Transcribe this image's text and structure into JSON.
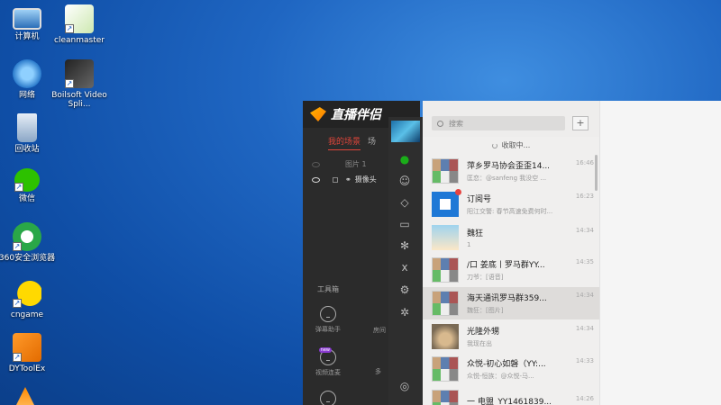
{
  "desktop": {
    "icons": [
      {
        "label": "计算机",
        "icon": "computer-icon"
      },
      {
        "label": "cleanmaster",
        "icon": "cleanmaster-icon"
      },
      {
        "label": "网络",
        "icon": "network-icon"
      },
      {
        "label": "Boilsoft Video Spli...",
        "icon": "video-splitter-icon"
      },
      {
        "label": "回收站",
        "icon": "recycle-bin-icon"
      },
      {
        "label": "微信",
        "icon": "wechat-icon"
      },
      {
        "label": "360安全浏览器",
        "icon": "360-browser-icon"
      },
      {
        "label": "cngame",
        "icon": "cngame-icon"
      },
      {
        "label": "DYToolEx",
        "icon": "dytoolex-icon"
      }
    ]
  },
  "stream_app": {
    "brand": "直播伴侣",
    "tab_active": "我的场景",
    "tab_other": "场",
    "rows": [
      {
        "label": "图片 1"
      },
      {
        "label": "摄像头"
      }
    ],
    "tools_title": "工具箱",
    "tools": [
      {
        "label": "弹幕助手"
      },
      {
        "label": "房间"
      },
      {
        "label": "视频连麦",
        "badge": "new"
      },
      {
        "label": "多"
      },
      {
        "label": ""
      }
    ]
  },
  "chat": {
    "search_placeholder": "搜索",
    "plus": "+",
    "receiving": "收取中...",
    "items": [
      {
        "name": "萍乡罗马协会歪歪14...",
        "time": "16:46",
        "msg": "匡恋：@sanfeng 我没空 ...",
        "avatar": "grid"
      },
      {
        "name": "订阅号",
        "time": "16:23",
        "msg": "阳江交警: 春节高速免费何时...",
        "avatar": "blue",
        "dot": true
      },
      {
        "name": "魏狂",
        "time": "14:34",
        "msg": "1",
        "avatar": "anime"
      },
      {
        "name": "/口  姜底丨罗马群YY...",
        "time": "14:35",
        "msg": "刀爷：[语音]",
        "avatar": "grid"
      },
      {
        "name": "海天通讯罗马群359...",
        "time": "14:34",
        "msg": "魏狂：[图片]",
        "avatar": "grid",
        "selected": true
      },
      {
        "name": "光隆外甥",
        "time": "14:34",
        "msg": "我现在出",
        "avatar": "cat"
      },
      {
        "name": "众悦-初心如磐（YY:...",
        "time": "14:33",
        "msg": "众悦-恒族：@众悦-马...",
        "avatar": "grid"
      },
      {
        "name": "一 电盟_YY1461839...",
        "time": "14:26",
        "msg": "",
        "avatar": "grid"
      }
    ]
  }
}
